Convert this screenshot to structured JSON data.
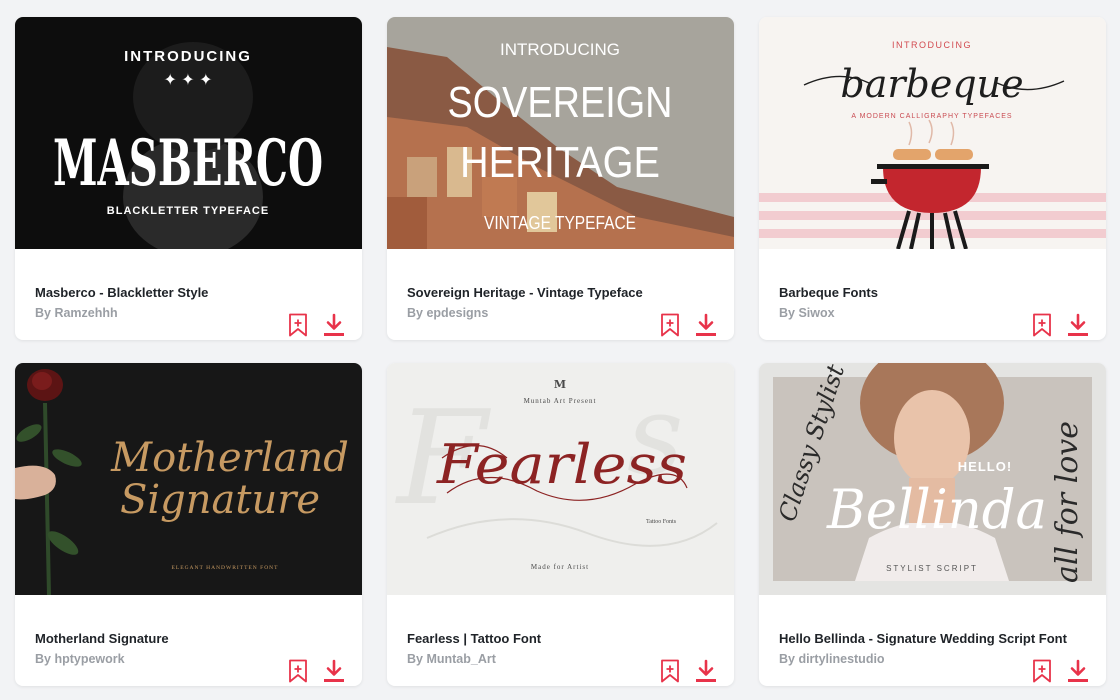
{
  "accent_color": "#e8334a",
  "cards": [
    {
      "title": "Masberco - Blackletter Style",
      "author": "By Ramzehhh",
      "preview": {
        "line1": "INTRODUCING",
        "line2": "MASBERCO",
        "line3": "BLACKLETTER TYPEFACE"
      }
    },
    {
      "title": "Sovereign Heritage - Vintage Typeface",
      "author": "By epdesigns",
      "preview": {
        "line1": "INTRODUCING",
        "line2": "SOVEREIGN",
        "line3": "HERITAGE",
        "line4": "VINTAGE TYPEFACE"
      }
    },
    {
      "title": "Barbeque Fonts",
      "author": "By Siwox",
      "preview": {
        "line1": "INTRODUCING",
        "line2": "barbeque",
        "line3": "A MODERN CALLIGRAPHY TYPEFACES"
      }
    },
    {
      "title": "Motherland Signature",
      "author": "By hptypework",
      "preview": {
        "line1": "Motherland",
        "line2": "Signature",
        "line3": "ELEGANT HANDWRITTEN FONT"
      }
    },
    {
      "title": "Fearless | Tattoo Font",
      "author": "By Muntab_Art",
      "preview": {
        "line1": "Muntab Art Present",
        "line2": "Fearless",
        "line3": "Tattoo Fonts",
        "line4": "Made for Artist"
      }
    },
    {
      "title": "Hello Bellinda - Signature Wedding Script Font",
      "author": "By dirtylinestudio",
      "preview": {
        "line1": "HELLO!",
        "line2": "Bellinda",
        "line3": "STYLIST SCRIPT",
        "line4": "Classy Stylist",
        "line5": "all for love"
      }
    }
  ]
}
